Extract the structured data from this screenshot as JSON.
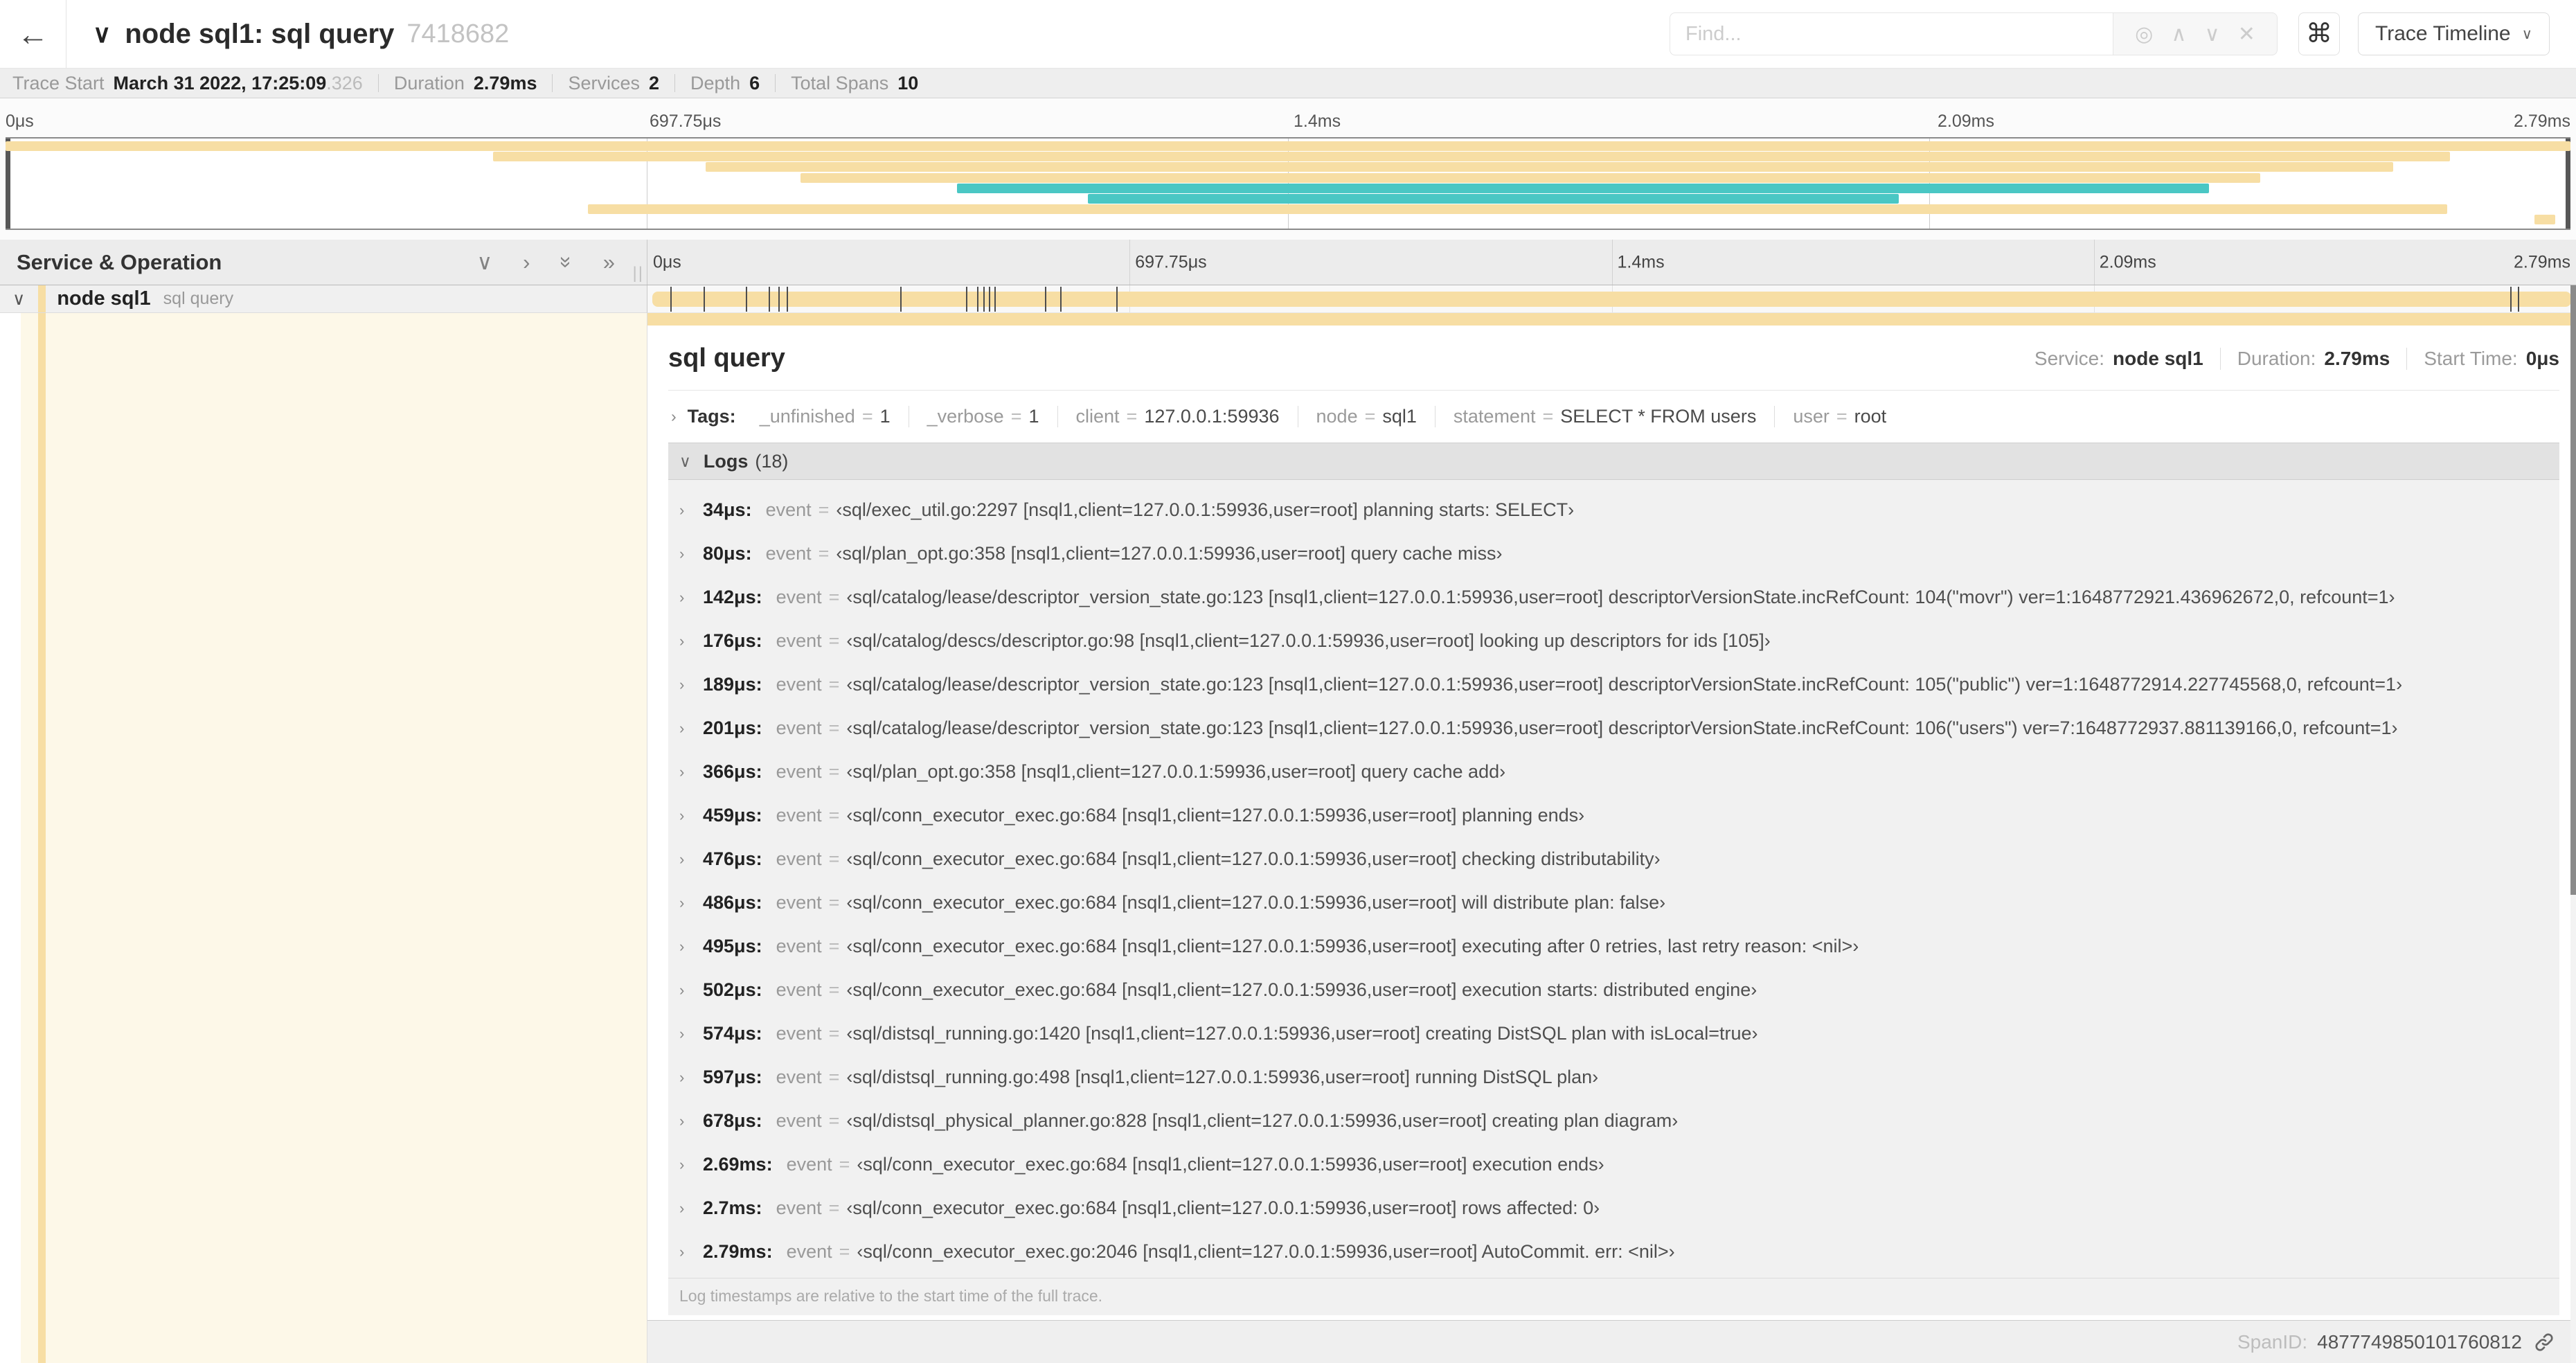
{
  "header": {
    "title": "node sql1: sql query",
    "trace_id_short": "7418682",
    "find_placeholder": "Find...",
    "view_selector": "Trace Timeline"
  },
  "icons": {
    "back": "←",
    "collapse_title": "∨",
    "focus_match": "◎",
    "prev_match": "∧",
    "next_match": "∨",
    "clear_match": "✕",
    "keyboard_shortcuts": "⌘",
    "dropdown_chevron": "∨",
    "collapse_one": "∨",
    "expand_one": "›",
    "collapse_all": "»",
    "expand_all": "»",
    "row_expanded": "∨",
    "item_chevron": "›",
    "resize_grip": "||"
  },
  "trace_info": {
    "items": [
      {
        "label": "Trace Start",
        "value": "March 31 2022, 17:25:09",
        "dim": ".326"
      },
      {
        "label": "Duration",
        "value": "2.79ms",
        "dim": ""
      },
      {
        "label": "Services",
        "value": "2",
        "dim": ""
      },
      {
        "label": "Depth",
        "value": "6",
        "dim": ""
      },
      {
        "label": "Total Spans",
        "value": "10",
        "dim": ""
      }
    ]
  },
  "colors": {
    "span_tan": "#f7dea4",
    "span_teal": "#4ac7c4",
    "detail_bg": "#fdf8e8"
  },
  "minimap": {
    "ticks": [
      "0μs",
      "697.75μs",
      "1.4ms",
      "2.09ms",
      "2.79ms"
    ],
    "gridlines_pct": [
      25,
      50,
      75
    ],
    "rows": [
      {
        "start": 0,
        "end": 100,
        "color": "tan"
      },
      {
        "start": 19.0,
        "end": 95.3,
        "color": "tan"
      },
      {
        "start": 27.3,
        "end": 93.1,
        "color": "tan"
      },
      {
        "start": 31.0,
        "end": 87.9,
        "color": "tan"
      },
      {
        "start": 37.1,
        "end": 85.9,
        "color": "teal"
      },
      {
        "start": 42.2,
        "end": 73.8,
        "color": "teal"
      },
      {
        "start": 22.7,
        "end": 95.2,
        "color": "tan"
      },
      {
        "start": 98.6,
        "end": 99.4,
        "color": "tan"
      }
    ]
  },
  "timeline": {
    "left_header": "Service & Operation",
    "ruler_ticks": [
      "0μs",
      "697.75μs",
      "1.4ms",
      "2.09ms",
      "2.79ms"
    ],
    "gridlines_pct": [
      25,
      50,
      75
    ],
    "span": {
      "service": "node sql1",
      "operation": "sql query",
      "log_marker_pct": [
        1.2,
        2.9,
        5.1,
        6.3,
        6.8,
        7.2,
        13.1,
        16.5,
        17.1,
        17.4,
        17.7,
        18.0,
        20.6,
        21.4,
        24.3,
        96.6,
        97.0,
        99.7
      ]
    }
  },
  "detail": {
    "operation": "sql query",
    "meta": [
      {
        "label": "Service:",
        "value": "node sql1"
      },
      {
        "label": "Duration:",
        "value": "2.79ms"
      },
      {
        "label": "Start Time:",
        "value": "0μs"
      }
    ],
    "tags_label": "Tags:",
    "tags": [
      {
        "key": "_unfinished",
        "value": "1"
      },
      {
        "key": "_verbose",
        "value": "1"
      },
      {
        "key": "client",
        "value": "127.0.0.1:59936"
      },
      {
        "key": "node",
        "value": "sql1"
      },
      {
        "key": "statement",
        "value": "SELECT * FROM users"
      },
      {
        "key": "user",
        "value": "root"
      }
    ],
    "logs_label": "Logs",
    "logs_count": "(18)",
    "logs": [
      {
        "time": "34μs:",
        "field": "event",
        "value": "‹sql/exec_util.go:2297 [nsql1,client=127.0.0.1:59936,user=root] planning starts: SELECT›"
      },
      {
        "time": "80μs:",
        "field": "event",
        "value": "‹sql/plan_opt.go:358 [nsql1,client=127.0.0.1:59936,user=root] query cache miss›"
      },
      {
        "time": "142μs:",
        "field": "event",
        "value": "‹sql/catalog/lease/descriptor_version_state.go:123 [nsql1,client=127.0.0.1:59936,user=root] descriptorVersionState.incRefCount: 104(\"movr\") ver=1:1648772921.436962672,0, refcount=1›"
      },
      {
        "time": "176μs:",
        "field": "event",
        "value": "‹sql/catalog/descs/descriptor.go:98 [nsql1,client=127.0.0.1:59936,user=root] looking up descriptors for ids [105]›"
      },
      {
        "time": "189μs:",
        "field": "event",
        "value": "‹sql/catalog/lease/descriptor_version_state.go:123 [nsql1,client=127.0.0.1:59936,user=root] descriptorVersionState.incRefCount: 105(\"public\") ver=1:1648772914.227745568,0, refcount=1›"
      },
      {
        "time": "201μs:",
        "field": "event",
        "value": "‹sql/catalog/lease/descriptor_version_state.go:123 [nsql1,client=127.0.0.1:59936,user=root] descriptorVersionState.incRefCount: 106(\"users\") ver=7:1648772937.881139166,0, refcount=1›"
      },
      {
        "time": "366μs:",
        "field": "event",
        "value": "‹sql/plan_opt.go:358 [nsql1,client=127.0.0.1:59936,user=root] query cache add›"
      },
      {
        "time": "459μs:",
        "field": "event",
        "value": "‹sql/conn_executor_exec.go:684 [nsql1,client=127.0.0.1:59936,user=root] planning ends›"
      },
      {
        "time": "476μs:",
        "field": "event",
        "value": "‹sql/conn_executor_exec.go:684 [nsql1,client=127.0.0.1:59936,user=root] checking distributability›"
      },
      {
        "time": "486μs:",
        "field": "event",
        "value": "‹sql/conn_executor_exec.go:684 [nsql1,client=127.0.0.1:59936,user=root] will distribute plan: false›"
      },
      {
        "time": "495μs:",
        "field": "event",
        "value": "‹sql/conn_executor_exec.go:684 [nsql1,client=127.0.0.1:59936,user=root] executing after 0 retries, last retry reason: <nil>›"
      },
      {
        "time": "502μs:",
        "field": "event",
        "value": "‹sql/conn_executor_exec.go:684 [nsql1,client=127.0.0.1:59936,user=root] execution starts: distributed engine›"
      },
      {
        "time": "574μs:",
        "field": "event",
        "value": "‹sql/distsql_running.go:1420 [nsql1,client=127.0.0.1:59936,user=root] creating DistSQL plan with isLocal=true›"
      },
      {
        "time": "597μs:",
        "field": "event",
        "value": "‹sql/distsql_running.go:498 [nsql1,client=127.0.0.1:59936,user=root] running DistSQL plan›"
      },
      {
        "time": "678μs:",
        "field": "event",
        "value": "‹sql/distsql_physical_planner.go:828 [nsql1,client=127.0.0.1:59936,user=root] creating plan diagram›"
      },
      {
        "time": "2.69ms:",
        "field": "event",
        "value": "‹sql/conn_executor_exec.go:684 [nsql1,client=127.0.0.1:59936,user=root] execution ends›"
      },
      {
        "time": "2.7ms:",
        "field": "event",
        "value": "‹sql/conn_executor_exec.go:684 [nsql1,client=127.0.0.1:59936,user=root] rows affected: 0›"
      },
      {
        "time": "2.79ms:",
        "field": "event",
        "value": "‹sql/conn_executor_exec.go:2046 [nsql1,client=127.0.0.1:59936,user=root] AutoCommit. err: <nil>›"
      }
    ],
    "logs_note": "Log timestamps are relative to the start time of the full trace.",
    "span_id_label": "SpanID:",
    "span_id": "4877749850101760812"
  }
}
